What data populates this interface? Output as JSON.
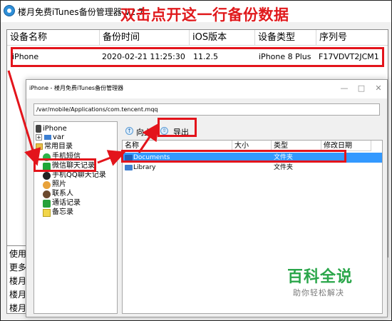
{
  "main_window": {
    "title": "楼月免费iTunes备份管理器 V2.7",
    "caption": "双击点开这一行备份数据"
  },
  "device_table": {
    "columns": [
      "设备名称",
      "备份时间",
      "iOS版本",
      "设备类型",
      "序列号"
    ],
    "rows": [
      {
        "name": "iPhone",
        "time": "2020-02-21 11:25:30",
        "ios": "11.2.5",
        "type": "iPhone 8 Plus",
        "serial": "F17VDVT2JCM1"
      }
    ]
  },
  "log_lines": [
    "使用i",
    "更多i",
    "楼月i",
    "楼月5",
    "楼月5"
  ],
  "child_window": {
    "title": "iPhone - 楼月免费iTunes备份管理器",
    "buttons": {
      "minimize": "—",
      "maximize": "□",
      "close": "✕"
    },
    "path": "/var/mobile/Applications/com.tencent.mqq",
    "toolbar": {
      "up_label": "向上",
      "export_label": "导出"
    },
    "tree": {
      "root": "iPhone",
      "var": "var",
      "common": "常用目录",
      "items": [
        "手机短信",
        "微信聊天记录",
        "手机QQ聊天记录",
        "照片",
        "联系人",
        "通话记录",
        "备忘录"
      ]
    },
    "file_list": {
      "columns": [
        "名称",
        "大小",
        "类型",
        "修改日期"
      ],
      "rows": [
        {
          "name": "Documents",
          "size": "",
          "type": "文件夹",
          "date": ""
        },
        {
          "name": "Library",
          "size": "",
          "type": "文件夹",
          "date": ""
        }
      ]
    }
  },
  "watermark": {
    "title": "百科全说",
    "subtitle": "助你轻松解决"
  },
  "colors": {
    "highlight": "#e3141b",
    "accent": "#2e8fd8",
    "selection": "#3399ff",
    "watermark": "#2aa64a"
  }
}
